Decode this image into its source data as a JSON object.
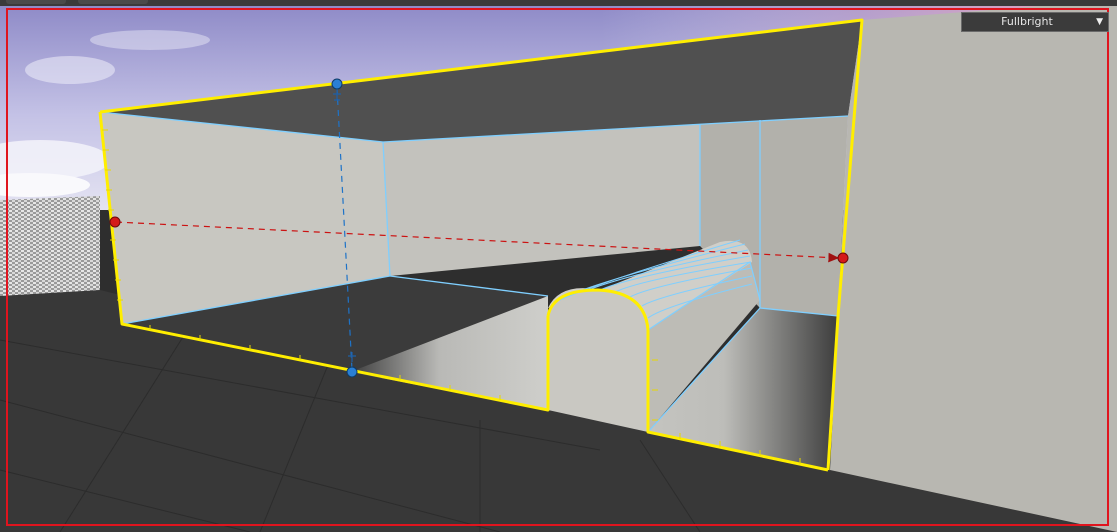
{
  "viewport": {
    "render_mode": {
      "selected": "Fullbright",
      "arrow_icon": "triangle-down"
    }
  },
  "colors": {
    "selection": "#ffee00",
    "wire": "#7fcfff",
    "frame": "#e0141e",
    "gizmo_red": "#cc1111",
    "gizmo_blue": "#1e73c8",
    "wall": "#b8b7b1",
    "ceiling": "#505050",
    "floor": "#3b3b3b"
  }
}
